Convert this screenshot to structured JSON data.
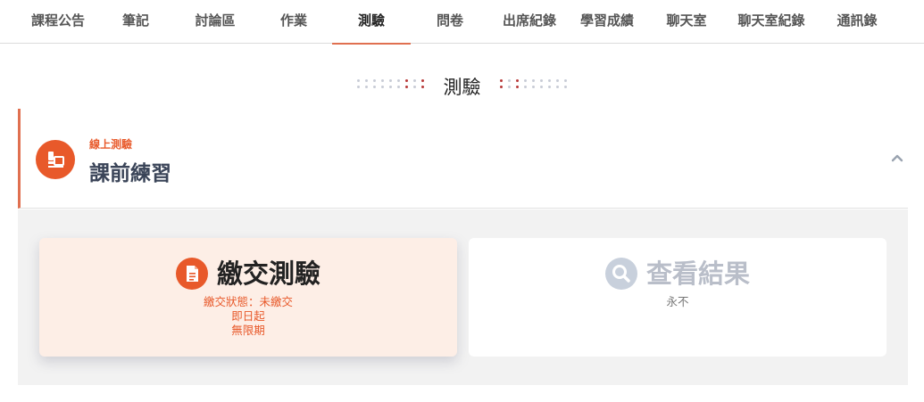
{
  "tabs": [
    {
      "label": "課程公告",
      "active": false
    },
    {
      "label": "筆記",
      "active": false
    },
    {
      "label": "討論區",
      "active": false
    },
    {
      "label": "作業",
      "active": false
    },
    {
      "label": "測驗",
      "active": true
    },
    {
      "label": "問卷",
      "active": false
    },
    {
      "label": "出席紀錄",
      "active": false
    },
    {
      "label": "學習成績",
      "active": false
    },
    {
      "label": "聊天室",
      "active": false
    },
    {
      "label": "聊天室紀錄",
      "active": false
    },
    {
      "label": "通訊錄",
      "active": false
    }
  ],
  "section": {
    "title": "測驗"
  },
  "quiz": {
    "type_label": "線上測驗",
    "title": "課前練習"
  },
  "actions": {
    "submit": {
      "title": "繳交測驗",
      "status": "繳交狀態：未繳交",
      "start": "即日起",
      "end": "無限期"
    },
    "results": {
      "title": "查看結果",
      "note": "永不"
    }
  },
  "colors": {
    "accent": "#e8592a",
    "tab_underline": "#e07050",
    "submit_card_bg": "#fdeee6",
    "muted_icon": "#c8d0dc"
  }
}
